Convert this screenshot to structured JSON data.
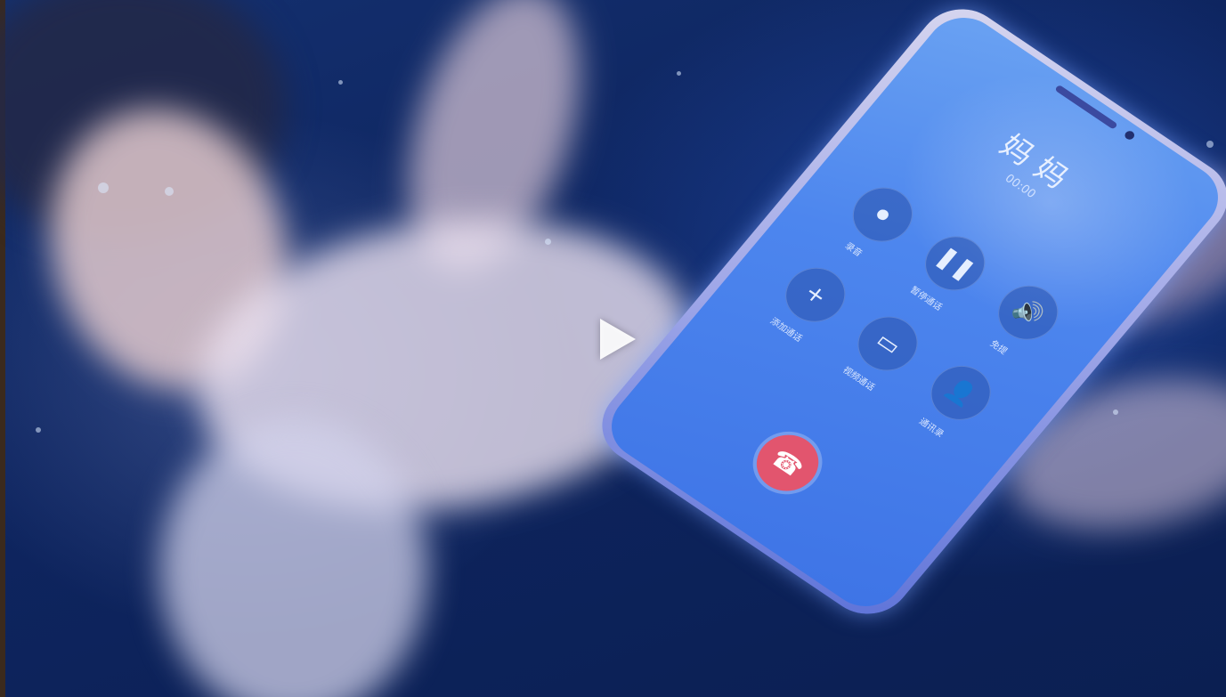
{
  "video": {
    "phone": {
      "caller_name": "妈妈",
      "caller_sub": "00:00",
      "status_time": "",
      "status_icons": "",
      "buttons": [
        {
          "label": "录音",
          "icon": "record-icon"
        },
        {
          "label": "暂停通话",
          "icon": "pause-icon"
        },
        {
          "label": "免提",
          "icon": "speaker-icon"
        },
        {
          "label": "添加通话",
          "icon": "add-call-icon"
        },
        {
          "label": "视频通话",
          "icon": "video-call-icon"
        },
        {
          "label": "通讯录",
          "icon": "contacts-icon"
        }
      ],
      "hangup_icon": "hangup-icon"
    },
    "play_icon": "play-icon"
  },
  "colors": {
    "background": "#0f2a66",
    "screen": "#4d86ee",
    "hangup": "#e2556e"
  }
}
